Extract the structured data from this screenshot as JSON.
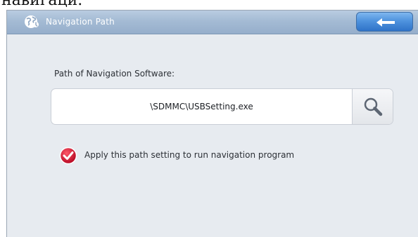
{
  "page_caption": "навигаци.",
  "window": {
    "title": "Navigation Path",
    "title_icon": "globe-icon",
    "back_button": {
      "icon": "arrow-left-icon"
    }
  },
  "path_section": {
    "label": "Path of Navigation Software:",
    "value": "\\SDMMC\\USBSetting.exe",
    "browse_icon": "search-icon"
  },
  "apply_option": {
    "checked": true,
    "label": "Apply this path setting to run navigation program",
    "icon": "check-circle-icon"
  },
  "colors": {
    "titlebar": "#a4bbd4",
    "back_button": "#4f93de",
    "content_bg": "#e7ebf0",
    "check_red": "#c8102e"
  }
}
